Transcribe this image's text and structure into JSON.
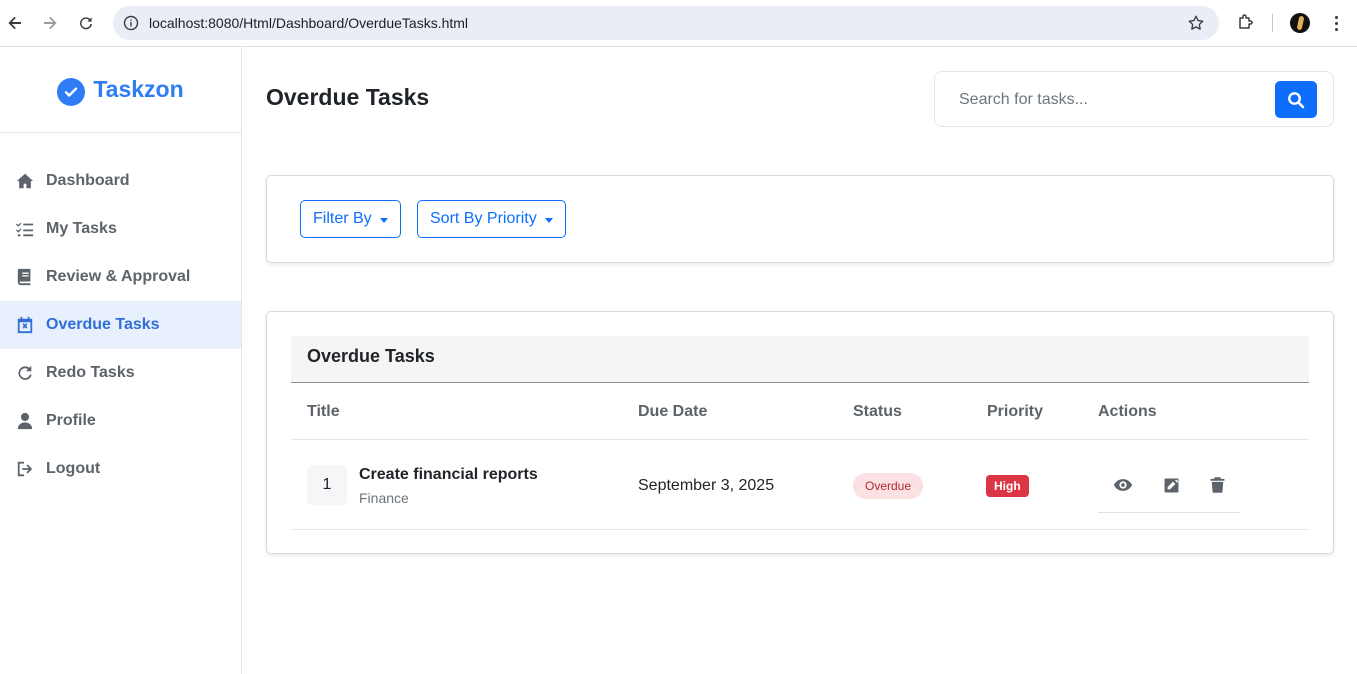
{
  "browser": {
    "url": "localhost:8080/Html/Dashboard/OverdueTasks.html"
  },
  "brand": {
    "name": "Taskzon",
    "color": "#2f7df6"
  },
  "sidebar": {
    "items": [
      {
        "label": "Dashboard",
        "icon": "home-icon",
        "active": false
      },
      {
        "label": "My Tasks",
        "icon": "list-check-icon",
        "active": false
      },
      {
        "label": "Review & Approval",
        "icon": "book-icon",
        "active": false
      },
      {
        "label": "Overdue Tasks",
        "icon": "calendar-x-icon",
        "active": true
      },
      {
        "label": "Redo Tasks",
        "icon": "redo-icon",
        "active": false
      },
      {
        "label": "Profile",
        "icon": "user-icon",
        "active": false
      },
      {
        "label": "Logout",
        "icon": "logout-icon",
        "active": false
      }
    ]
  },
  "header": {
    "title": "Overdue Tasks",
    "search_placeholder": "Search for tasks..."
  },
  "filters": {
    "filter_label": "Filter By",
    "sort_label": "Sort By Priority"
  },
  "table": {
    "title": "Overdue Tasks",
    "columns": [
      "Title",
      "Due Date",
      "Status",
      "Priority",
      "Actions"
    ],
    "rows": [
      {
        "index": "1",
        "title": "Create financial reports",
        "category": "Finance",
        "due_date": "September 3, 2025",
        "status": "Overdue",
        "priority": "High"
      }
    ]
  },
  "colors": {
    "accent": "#0d6efd",
    "active_nav_bg": "#e8f0fe",
    "overdue_badge_bg": "#fbe1e3",
    "priority_high": "#dc3545"
  }
}
